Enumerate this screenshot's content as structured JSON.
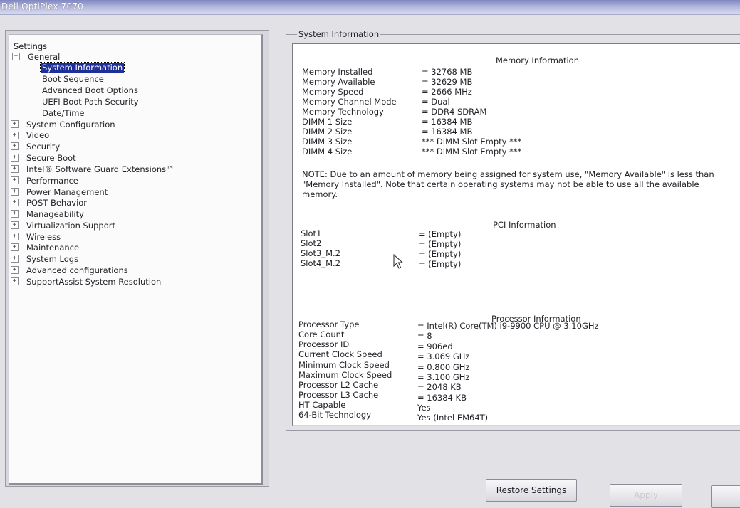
{
  "window": {
    "title": "Dell OptiPlex 7070"
  },
  "tree": {
    "root_label": "Settings",
    "general_label": "General",
    "general_children": [
      "System Information",
      "Boot Sequence",
      "Advanced Boot Options",
      "UEFI Boot Path Security",
      "Date/Time"
    ],
    "groups": [
      "System Configuration",
      "Video",
      "Security",
      "Secure Boot",
      "Intel® Software Guard Extensions™",
      "Performance",
      "Power Management",
      "POST Behavior",
      "Manageability",
      "Virtualization Support",
      "Wireless",
      "Maintenance",
      "System Logs",
      "Advanced configurations",
      "SupportAssist System Resolution"
    ],
    "expanded_symbol": "−",
    "collapsed_symbol": "+"
  },
  "section": {
    "title": "System Information",
    "memory_heading": "Memory Information",
    "memory": [
      {
        "label": "Memory Installed",
        "value": "= 32768 MB"
      },
      {
        "label": "Memory Available",
        "value": "= 32629 MB"
      },
      {
        "label": "Memory Speed",
        "value": "= 2666 MHz"
      },
      {
        "label": "Memory Channel Mode",
        "value": "= Dual"
      },
      {
        "label": "Memory Technology",
        "value": "= DDR4 SDRAM"
      },
      {
        "label": "DIMM 1 Size",
        "value": "= 16384 MB"
      },
      {
        "label": "DIMM 2 Size",
        "value": "= 16384 MB"
      },
      {
        "label": "DIMM 3 Size",
        "value": "*** DIMM Slot Empty ***"
      },
      {
        "label": "DIMM 4 Size",
        "value": "*** DIMM Slot Empty ***"
      }
    ],
    "note": "NOTE: Due to an amount of memory being assigned for system use, \"Memory Available\" is less than \"Memory Installed\". Note that certain operating systems may not be able to use all the available memory.",
    "pci_heading": "PCI Information",
    "pci": [
      {
        "label": "Slot1",
        "value": "= (Empty)"
      },
      {
        "label": "Slot2",
        "value": "= (Empty)"
      },
      {
        "label": "Slot3_M.2",
        "value": "= (Empty)"
      },
      {
        "label": "Slot4_M.2",
        "value": "= (Empty)"
      }
    ],
    "processor_heading": "Processor Information",
    "processor": [
      {
        "label": "Processor Type",
        "value": "= Intel(R) Core(TM) i9-9900 CPU @ 3.10GHz"
      },
      {
        "label": "Core Count",
        "value": "= 8"
      },
      {
        "label": "Processor ID",
        "value": "= 906ed"
      },
      {
        "label": "Current Clock Speed",
        "value": "= 3.069 GHz"
      },
      {
        "label": "Minimum Clock Speed",
        "value": "= 0.800 GHz"
      },
      {
        "label": "Maximum Clock Speed",
        "value": "= 3.100 GHz"
      },
      {
        "label": "Processor L2 Cache",
        "value": "= 2048 KB"
      },
      {
        "label": "Processor L3 Cache",
        "value": "= 16384 KB"
      },
      {
        "label": "HT Capable",
        "value": "Yes"
      },
      {
        "label": "64-Bit Technology",
        "value": "Yes (Intel EM64T)"
      }
    ]
  },
  "buttons": {
    "restore": "Restore Settings",
    "apply": "Apply"
  },
  "colors": {
    "selection": "#1f2f9a",
    "titlebar": "#7f86c2",
    "background": "#e2e1e6"
  }
}
